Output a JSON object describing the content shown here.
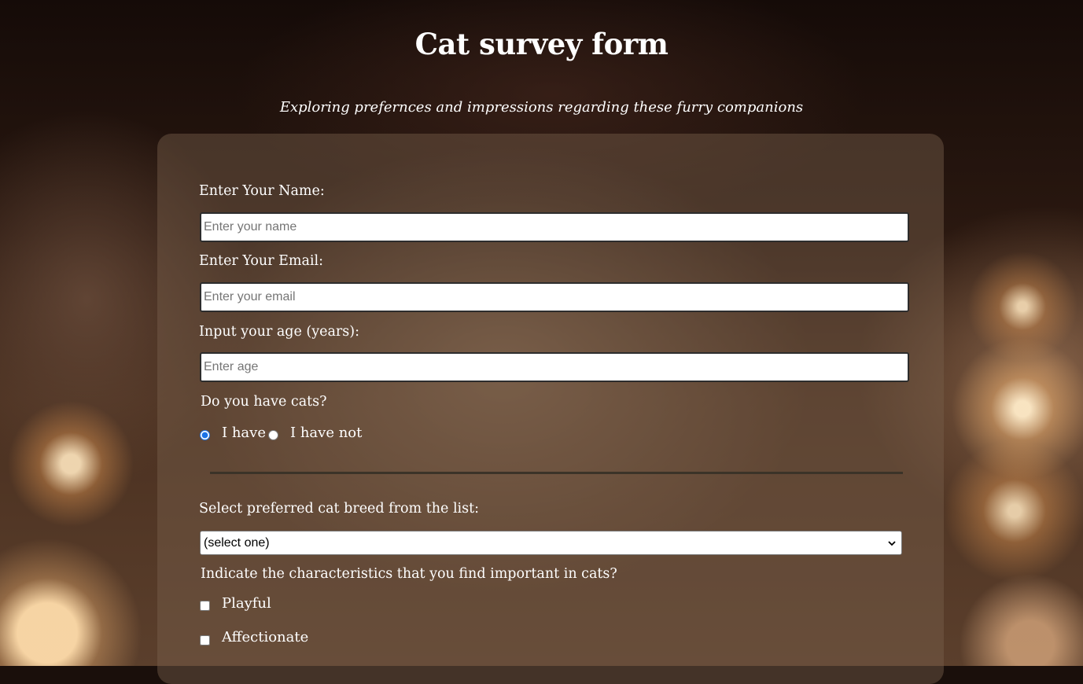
{
  "page": {
    "title": "Cat survey form",
    "subtitle": "Exploring prefernces and impressions regarding these furry companions"
  },
  "form": {
    "name": {
      "label": "Enter Your Name:",
      "placeholder": "Enter your name",
      "value": ""
    },
    "email": {
      "label": "Enter Your Email:",
      "placeholder": "Enter your email",
      "value": ""
    },
    "age": {
      "label": "Input your age (years):",
      "placeholder": "Enter age",
      "value": ""
    },
    "have_cats": {
      "question": "Do you have cats?",
      "options": [
        {
          "label": "I have",
          "checked": true
        },
        {
          "label": "I have not",
          "checked": false
        }
      ]
    },
    "breed": {
      "label": "Select preferred cat breed from the list:",
      "selected": "(select one)"
    },
    "characteristics": {
      "question": "Indicate the characteristics that you find important in cats?",
      "options": [
        {
          "label": "Playful",
          "checked": false
        },
        {
          "label": "Affectionate",
          "checked": false
        }
      ]
    }
  },
  "icons": {
    "select_arrow": "chevron-down-icon"
  },
  "colors": {
    "radio_accent": "#1a73e8",
    "divider": "#3b3328"
  }
}
